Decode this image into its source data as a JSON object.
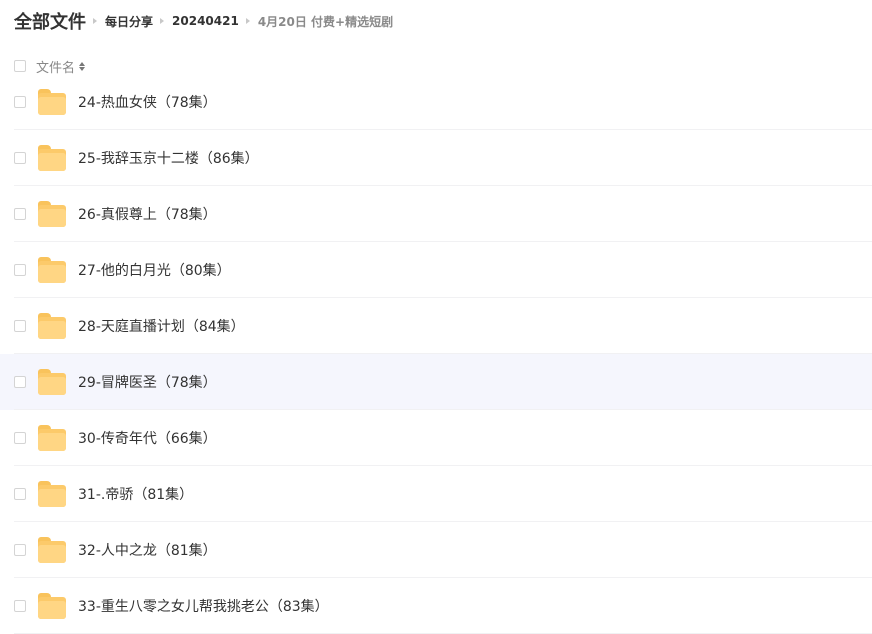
{
  "breadcrumb": {
    "root": "全部文件",
    "items": [
      "每日分享",
      "20240421",
      "4月20日 付费+精选短剧"
    ]
  },
  "list_header": {
    "name_label": "文件名",
    "sort_icon": "sort-icon"
  },
  "files": [
    {
      "name": "24-热血女侠（78集）",
      "icon": "folder-icon"
    },
    {
      "name": "25-我辞玉京十二楼（86集）",
      "icon": "folder-icon"
    },
    {
      "name": "26-真假尊上（78集）",
      "icon": "folder-icon"
    },
    {
      "name": "27-他的白月光（80集）",
      "icon": "folder-icon"
    },
    {
      "name": "28-天庭直播计划（84集）",
      "icon": "folder-icon"
    },
    {
      "name": "29-冒牌医圣（78集）",
      "icon": "folder-icon",
      "hovered": true
    },
    {
      "name": "30-传奇年代（66集）",
      "icon": "folder-icon"
    },
    {
      "name": "31-.帝骄（81集）",
      "icon": "folder-icon"
    },
    {
      "name": "32-人中之龙（81集）",
      "icon": "folder-icon"
    },
    {
      "name": "33-重生八零之女儿帮我挑老公（83集）",
      "icon": "folder-icon"
    }
  ],
  "colors": {
    "folder": "#fcca6a",
    "hover_row": "#f5f6fd"
  }
}
